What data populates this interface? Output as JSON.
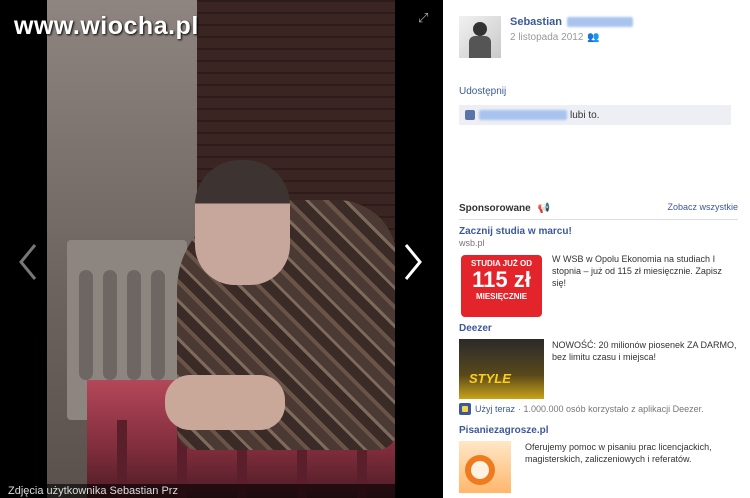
{
  "watermark": "www.wiocha.pl",
  "caption": "Zdjęcia użytkownika Sebastian Prz",
  "author": {
    "name": "Sebastian",
    "date": "2 listopada 2012"
  },
  "share_label": "Udostępnij",
  "likes_text": "lubi to.",
  "sponsored": {
    "title": "Sponsorowane",
    "see_all": "Zobacz wszystkie"
  },
  "ads": [
    {
      "title": "Zacznij studia w marcu!",
      "domain": "wsb.pl",
      "text": "W WSB w Opolu Ekonomia na studiach I stopnia – już od 115 zł miesięcznie. Zapisz się!",
      "promo": {
        "line1": "STUDIA JUŻ OD",
        "line2": "115 zł",
        "line3": "MIESIĘCZNIE"
      }
    },
    {
      "title": "Deezer",
      "text": "NOWOŚĆ: 20 milionów piosenek ZA DARMO, bez limitu czasu i miejsca!",
      "image_text": "STYLE",
      "use_now": "Użyj teraz",
      "app_users": "· 1.000.000 osób korzystało z aplikacji Deezer."
    },
    {
      "title": "Pisaniezagrosze.pl",
      "text": "Oferujemy pomoc w pisaniu prac licencjackich, magisterskich, zaliczeniowych i referatów."
    }
  ],
  "colors": {
    "link": "#3b5998",
    "promo_red": "#e3242b"
  }
}
